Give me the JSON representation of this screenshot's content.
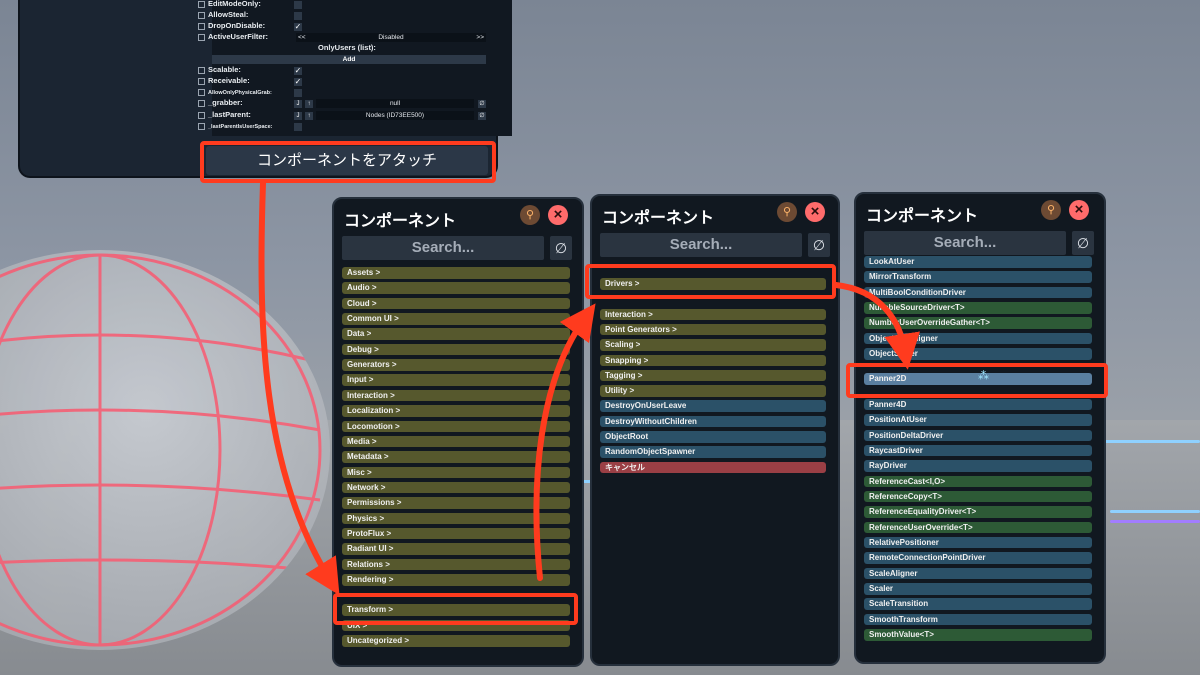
{
  "inspector": {
    "rows": [
      {
        "label": "EditModeOnly:",
        "checked": false
      },
      {
        "label": "AllowSteal:",
        "checked": false
      },
      {
        "label": "DropOnDisable:",
        "checked": true
      },
      {
        "label": "ActiveUserFilter:",
        "value": "Disabled"
      },
      {
        "label": "Scalable:",
        "checked": true
      },
      {
        "label": "Receivable:",
        "checked": true
      },
      {
        "label": "AllowOnlyPhysicalGrab:",
        "checked": false
      },
      {
        "label": "_grabber:",
        "value": "null"
      },
      {
        "label": "_lastParent:",
        "value": "Nodes (ID73EE500)"
      },
      {
        "label": "_lastParentIsUserSpace:",
        "checked": false
      }
    ],
    "only_users_label": "OnlyUsers (list):",
    "add_label": "Add",
    "prev_glyph": "<<",
    "next_glyph": ">>",
    "attach_button": "コンポーネントをアタッチ"
  },
  "panel_title": "コンポーネント",
  "search_placeholder": "Search...",
  "clear_glyph": "∅",
  "close_glyph": "×",
  "pin_glyph": "⚲",
  "panel1": {
    "items": [
      "Assets >",
      "Audio >",
      "Cloud >",
      "Common UI >",
      "Data >",
      "Debug >",
      "Generators >",
      "Input >",
      "Interaction >",
      "Localization >",
      "Locomotion >",
      "Media >",
      "Metadata >",
      "Misc >",
      "Network >",
      "Permissions >",
      "Physics >",
      "ProtoFlux >",
      "Radiant UI >",
      "Relations >",
      "Rendering >",
      "Transform >",
      "UIX >",
      "Uncategorized >"
    ]
  },
  "panel2": {
    "items": [
      {
        "label": "Drivers >",
        "kind": "cat"
      },
      {
        "label": "Interaction >",
        "kind": "cat"
      },
      {
        "label": "Point Generators >",
        "kind": "cat"
      },
      {
        "label": "Scaling >",
        "kind": "cat"
      },
      {
        "label": "Snapping >",
        "kind": "cat"
      },
      {
        "label": "Tagging >",
        "kind": "cat"
      },
      {
        "label": "Utility >",
        "kind": "cat"
      },
      {
        "label": "DestroyOnUserLeave",
        "kind": "comp"
      },
      {
        "label": "DestroyWithoutChildren",
        "kind": "comp"
      },
      {
        "label": "ObjectRoot",
        "kind": "comp"
      },
      {
        "label": "RandomObjectSpawner",
        "kind": "comp"
      },
      {
        "label": "キャンセル",
        "kind": "cancel"
      }
    ]
  },
  "panel3": {
    "items": [
      {
        "label": "LookAtUser",
        "kind": "comp"
      },
      {
        "label": "MirrorTransform",
        "kind": "comp"
      },
      {
        "label": "MultiBoolConditionDriver",
        "kind": "comp"
      },
      {
        "label": "NullableSourceDriver<T>",
        "kind": "gen"
      },
      {
        "label": "NumberUserOverrideGather<T>",
        "kind": "gen"
      },
      {
        "label": "ObjectGridAligner",
        "kind": "comp"
      },
      {
        "label": "ObjectScaler",
        "kind": "comp"
      },
      {
        "label": "Panner2D",
        "kind": "comp"
      },
      {
        "label": "Panner4D",
        "kind": "comp"
      },
      {
        "label": "PositionAtUser",
        "kind": "comp"
      },
      {
        "label": "PositionDeltaDriver",
        "kind": "comp"
      },
      {
        "label": "RaycastDriver",
        "kind": "comp"
      },
      {
        "label": "RayDriver",
        "kind": "comp"
      },
      {
        "label": "ReferenceCast<I,O>",
        "kind": "gen"
      },
      {
        "label": "ReferenceCopy<T>",
        "kind": "gen"
      },
      {
        "label": "ReferenceEqualityDriver<T>",
        "kind": "gen"
      },
      {
        "label": "ReferenceUserOverride<T>",
        "kind": "gen"
      },
      {
        "label": "RelativePositioner",
        "kind": "comp"
      },
      {
        "label": "RemoteConnectionPointDriver",
        "kind": "comp"
      },
      {
        "label": "ScaleAligner",
        "kind": "comp"
      },
      {
        "label": "Scaler",
        "kind": "comp"
      },
      {
        "label": "ScaleTransition",
        "kind": "comp"
      },
      {
        "label": "SmoothTransform",
        "kind": "comp"
      },
      {
        "label": "SmoothValue<T>",
        "kind": "gen"
      }
    ]
  },
  "colors": {
    "highlight": "#ff3b1e",
    "category": "#56582d",
    "component": "#2b5168",
    "generic": "#2d5a36",
    "cancel": "#9a3f45"
  }
}
